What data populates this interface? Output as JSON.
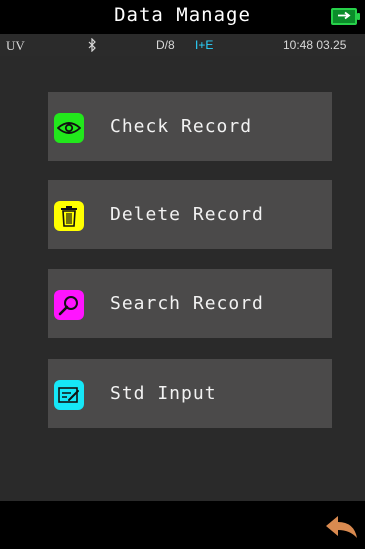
{
  "header": {
    "title": "Data Manage",
    "battery_color": "#27d14a"
  },
  "status": {
    "mode": "UV",
    "bluetooth_icon": "bluetooth-icon",
    "geometry": "D/8",
    "illumination": "I+E",
    "time": "10:48 03.25"
  },
  "menu": [
    {
      "label": "Check Record",
      "icon": "eye-icon",
      "color": "#22e81c"
    },
    {
      "label": "Delete Record",
      "icon": "trash-icon",
      "color": "#ffff00"
    },
    {
      "label": "Search Record",
      "icon": "magnifier-icon",
      "color": "#ff14ff"
    },
    {
      "label": "Std Input",
      "icon": "input-card-icon",
      "color": "#16e7f7"
    }
  ],
  "footer": {
    "back_icon": "back-arrow-icon",
    "back_color": "#d98a50"
  }
}
